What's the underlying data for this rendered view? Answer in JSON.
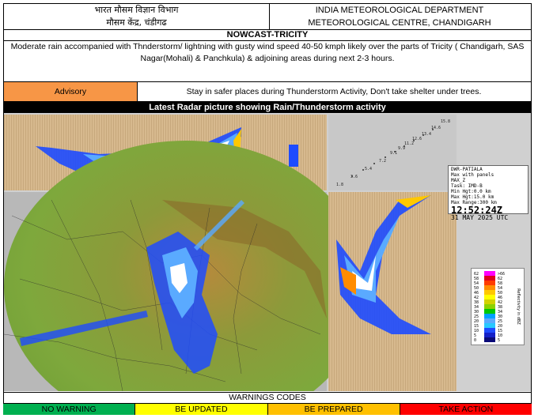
{
  "header": {
    "left_line1": "भारत मौसम विज्ञान विभाग",
    "left_line2": "मौसम केंद्र, चंडीगढ",
    "right_line1": "INDIA METEOROLOGICAL DEPARTMENT",
    "right_line2": "METEOROLOGICAL CENTRE, CHANDIGARH"
  },
  "title": "NOWCAST-TRICITY",
  "description": "Moderate rain accompanied with Thnderstorm/ lightning with gusty wind speed 40-50 kmph  likely over the parts of Tricity ( Chandigarh, SAS Nagar(Mohali) & Panchkula) & adjoining areas during next 2-3 hours.",
  "advisory": {
    "label": "Advisory",
    "text": "Stay in safer places during Thunderstorm Activity, Don't take shelter under trees."
  },
  "radar": {
    "title": "Latest Radar picture showing Rain/Thunderstorm activity",
    "station": "DWR-PATIALA",
    "product": "Max with panels",
    "product_code": "MAX_Z",
    "task": "Task: IMD-B",
    "min_hgt": "Min Hgt:0.0 km",
    "max_hgt": "Max Hgt:15.0 km",
    "max_range": "Max Range:300 km",
    "time": "12:52:24Z",
    "date": "31 MAY 2025 UTC",
    "scale_title": "Reflectivity in dBZ",
    "scale_values": [
      "62",
      "58",
      "54",
      "50",
      "46",
      "42",
      "38",
      "34",
      "30",
      "25",
      "20",
      "15",
      "10",
      "5",
      "0"
    ],
    "scale_values_right": ">66",
    "scale_values_right_list": [
      ">66",
      "62",
      "58",
      "54",
      "50",
      "46",
      "42",
      "38",
      "34",
      "30",
      "25",
      "20",
      "15",
      "10",
      "5"
    ],
    "scale_colors": [
      "#ff00ff",
      "#e0001c",
      "#ff3c00",
      "#ff8c00",
      "#ffc800",
      "#ffff00",
      "#d2d200",
      "#8cd200",
      "#00c800",
      "#00a0ff",
      "#5aaaff",
      "#28c8ff",
      "#1e4bff",
      "#1420c8",
      "#0a0a78"
    ],
    "height_labels": [
      "1.8",
      "3.6",
      "5.4",
      "7.2",
      "9.1",
      "9.9",
      "11.2",
      "12.6",
      "13.4",
      "14.6",
      "15.8"
    ]
  },
  "warnings": {
    "title": "WARNINGS CODES",
    "codes": [
      {
        "label": "NO WARNING",
        "color": "#00b050"
      },
      {
        "label": "BE UPDATED",
        "color": "#ffff00"
      },
      {
        "label": "BE PREPARED",
        "color": "#ffc000"
      },
      {
        "label": "TAKE ACTION",
        "color": "#ff0000"
      }
    ]
  }
}
